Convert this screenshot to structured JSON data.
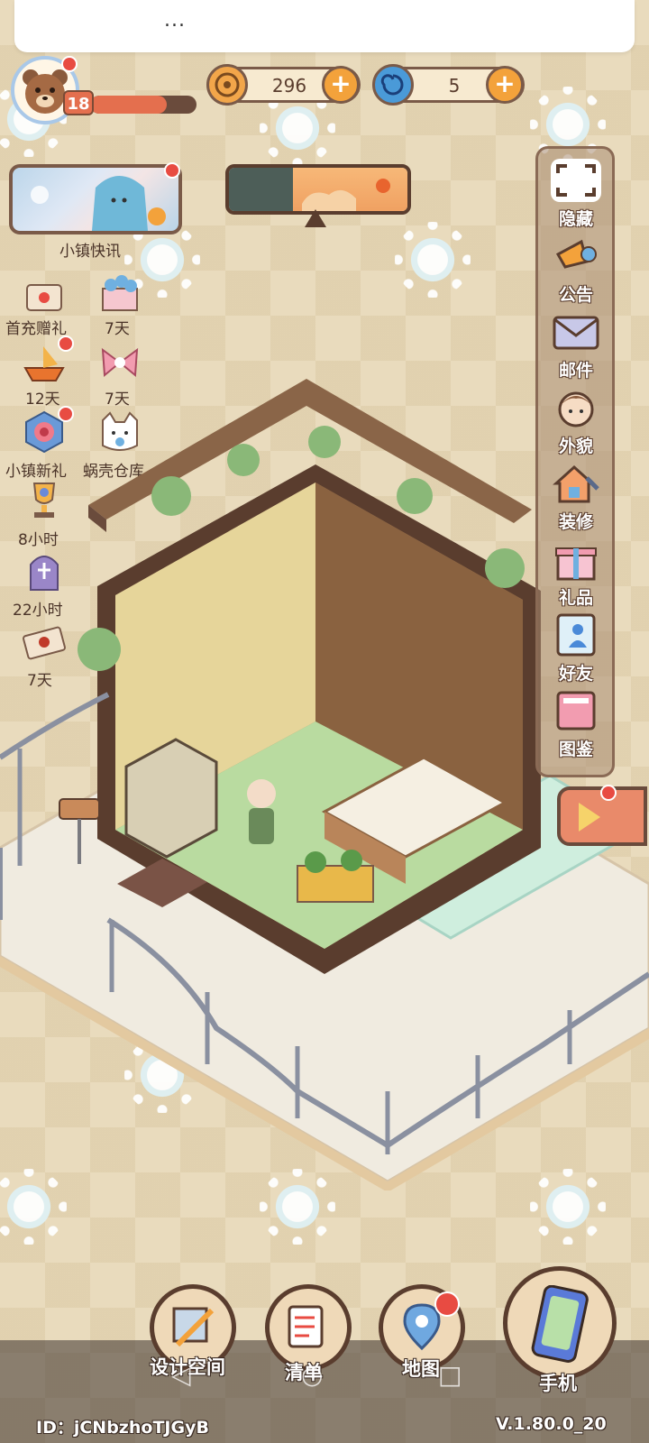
{
  "topbar": {
    "menu_label": "..."
  },
  "player": {
    "level": "18",
    "xp_progress": 0.72
  },
  "currency": {
    "coins": "296",
    "gems": "5",
    "plus_label": "+"
  },
  "news": {
    "label": "小镇快讯"
  },
  "left_icons": [
    {
      "id": "first-recharge",
      "label": "首充赠礼",
      "icon": "envelope-gift-icon"
    },
    {
      "id": "event-7d-a",
      "label": "7天",
      "icon": "blue-flower-box-icon"
    },
    {
      "id": "event-12d",
      "label": "12天",
      "icon": "fox-boat-icon"
    },
    {
      "id": "event-7d-b",
      "label": "7天",
      "icon": "pink-ribbon-icon"
    },
    {
      "id": "town-new",
      "label": "小镇新礼",
      "icon": "rose-badge-icon"
    },
    {
      "id": "shell-warehouse",
      "label": "蜗壳仓库",
      "icon": "cat-face-icon"
    },
    {
      "id": "event-8h",
      "label": "8小时",
      "icon": "trophy-icon"
    },
    {
      "id": "event-22h",
      "label": "22小时",
      "icon": "purple-tombstone-icon"
    },
    {
      "id": "event-7d-c",
      "label": "7天",
      "icon": "letter-seal-icon"
    }
  ],
  "sidebar": [
    {
      "id": "hide",
      "label": "隐藏",
      "icon": "frame-corners-icon"
    },
    {
      "id": "notice",
      "label": "公告",
      "icon": "megaphone-icon"
    },
    {
      "id": "mail",
      "label": "邮件",
      "icon": "mail-icon"
    },
    {
      "id": "appearance",
      "label": "外貌",
      "icon": "face-icon"
    },
    {
      "id": "decorate",
      "label": "装修",
      "icon": "house-wrench-icon"
    },
    {
      "id": "gift",
      "label": "礼品",
      "icon": "gift-box-icon"
    },
    {
      "id": "friends",
      "label": "好友",
      "icon": "friend-card-icon"
    },
    {
      "id": "collection",
      "label": "图鉴",
      "icon": "book-icon"
    }
  ],
  "bottom": {
    "design_space": "设计空间",
    "list": "清单",
    "map": "地图",
    "phone": "手机"
  },
  "footer": {
    "id": "ID：jCNbzhoTJGyB",
    "version": "V.1.80.0_20"
  },
  "colors": {
    "accent_orange": "#f3a23b",
    "dark_brown": "#5a3d2e",
    "alert_red": "#e84b42",
    "background": "#e9dbbd"
  }
}
